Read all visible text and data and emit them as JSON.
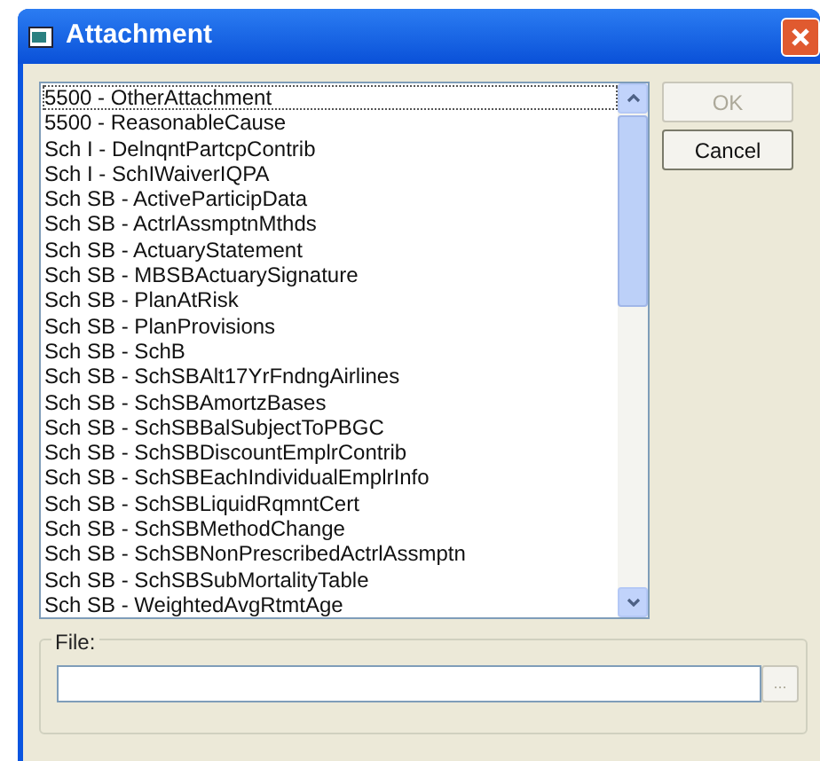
{
  "window": {
    "title": "Attachment"
  },
  "list": {
    "items": [
      {
        "label": "5500 - OtherAttachment",
        "focused": true
      },
      {
        "label": "5500 - ReasonableCause",
        "focused": false
      },
      {
        "label": "Sch I - DelnqntPartcpContrib",
        "focused": false
      },
      {
        "label": "Sch I - SchIWaiverIQPA",
        "focused": false
      },
      {
        "label": "Sch SB - ActiveParticipData",
        "focused": false
      },
      {
        "label": "Sch SB - ActrlAssmptnMthds",
        "focused": false
      },
      {
        "label": "Sch SB - ActuaryStatement",
        "focused": false
      },
      {
        "label": "Sch SB - MBSBActuarySignature",
        "focused": false
      },
      {
        "label": "Sch SB - PlanAtRisk",
        "focused": false
      },
      {
        "label": "Sch SB - PlanProvisions",
        "focused": false
      },
      {
        "label": "Sch SB - SchB",
        "focused": false
      },
      {
        "label": "Sch SB - SchSBAlt17YrFndngAirlines",
        "focused": false
      },
      {
        "label": "Sch SB - SchSBAmortzBases",
        "focused": false
      },
      {
        "label": "Sch SB - SchSBBalSubjectToPBGC",
        "focused": false
      },
      {
        "label": "Sch SB - SchSBDiscountEmplrContrib",
        "focused": false
      },
      {
        "label": "Sch SB - SchSBEachIndividualEmplrInfo",
        "focused": false
      },
      {
        "label": "Sch SB - SchSBLiquidRqmntCert",
        "focused": false
      },
      {
        "label": "Sch SB - SchSBMethodChange",
        "focused": false
      },
      {
        "label": "Sch SB - SchSBNonPrescribedActrlAssmptn",
        "focused": false
      },
      {
        "label": "Sch SB - SchSBSubMortalityTable",
        "focused": false
      },
      {
        "label": "Sch SB - WeightedAvgRtmtAge",
        "focused": false
      }
    ]
  },
  "buttons": [
    {
      "label": "OK",
      "disabled": true
    },
    {
      "label": "Cancel",
      "disabled": false
    }
  ],
  "file": {
    "label": "File:",
    "browse": {
      "label": "...",
      "disabled": true
    }
  }
}
